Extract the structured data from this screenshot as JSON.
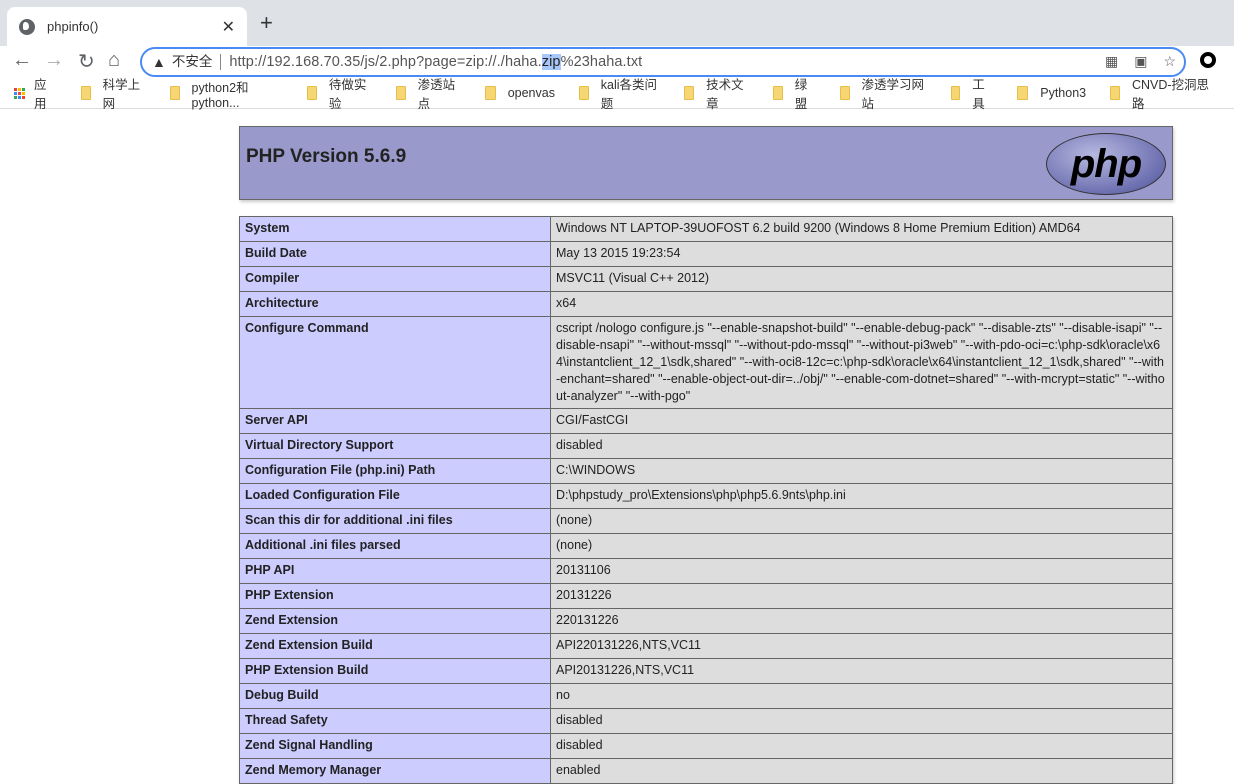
{
  "browser": {
    "tab_title": "phpinfo()",
    "insecure_label": "不安全",
    "url_before": "http://192.168.70.35/js/2.php?page=zip://./haha.",
    "url_selected": "zip",
    "url_after": "%23haha.txt",
    "bookmarks": [
      "应用",
      "科学上网",
      "python2和python...",
      "待做实验",
      "渗透站点",
      "openvas",
      "kali各类问题",
      "技术文章",
      "绿盟",
      "渗透学习网站",
      "工具",
      "Python3",
      "CNVD-挖洞思路"
    ]
  },
  "page": {
    "title": "PHP Version 5.6.9",
    "logo_text": "php",
    "rows": [
      [
        "System",
        "Windows NT LAPTOP-39UOFOST 6.2 build 9200 (Windows 8 Home Premium Edition) AMD64"
      ],
      [
        "Build Date",
        "May 13 2015 19:23:54"
      ],
      [
        "Compiler",
        "MSVC11 (Visual C++ 2012)"
      ],
      [
        "Architecture",
        "x64"
      ],
      [
        "Configure Command",
        "cscript /nologo configure.js \"--enable-snapshot-build\" \"--enable-debug-pack\" \"--disable-zts\" \"--disable-isapi\" \"--disable-nsapi\" \"--without-mssql\" \"--without-pdo-mssql\" \"--without-pi3web\" \"--with-pdo-oci=c:\\php-sdk\\oracle\\x64\\instantclient_12_1\\sdk,shared\" \"--with-oci8-12c=c:\\php-sdk\\oracle\\x64\\instantclient_12_1\\sdk,shared\" \"--with-enchant=shared\" \"--enable-object-out-dir=../obj/\" \"--enable-com-dotnet=shared\" \"--with-mcrypt=static\" \"--without-analyzer\" \"--with-pgo\""
      ],
      [
        "Server API",
        "CGI/FastCGI"
      ],
      [
        "Virtual Directory Support",
        "disabled"
      ],
      [
        "Configuration File (php.ini) Path",
        "C:\\WINDOWS"
      ],
      [
        "Loaded Configuration File",
        "D:\\phpstudy_pro\\Extensions\\php\\php5.6.9nts\\php.ini"
      ],
      [
        "Scan this dir for additional .ini files",
        "(none)"
      ],
      [
        "Additional .ini files parsed",
        "(none)"
      ],
      [
        "PHP API",
        "20131106"
      ],
      [
        "PHP Extension",
        "20131226"
      ],
      [
        "Zend Extension",
        "220131226"
      ],
      [
        "Zend Extension Build",
        "API220131226,NTS,VC11"
      ],
      [
        "PHP Extension Build",
        "API20131226,NTS,VC11"
      ],
      [
        "Debug Build",
        "no"
      ],
      [
        "Thread Safety",
        "disabled"
      ],
      [
        "Zend Signal Handling",
        "disabled"
      ],
      [
        "Zend Memory Manager",
        "enabled"
      ]
    ]
  }
}
